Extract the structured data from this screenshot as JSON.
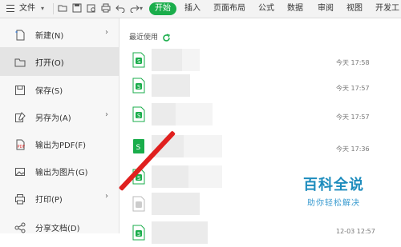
{
  "toolbar": {
    "file_menu_label": "文件",
    "tabs": [
      "开始",
      "插入",
      "页面布局",
      "公式",
      "数据",
      "审阅",
      "视图",
      "开发工"
    ]
  },
  "file_menu": {
    "items": [
      {
        "label": "新建(N)",
        "icon": "new-file-icon",
        "has_submenu": true
      },
      {
        "label": "打开(O)",
        "icon": "open-folder-icon",
        "has_submenu": false,
        "active": true
      },
      {
        "label": "保存(S)",
        "icon": "save-icon",
        "has_submenu": false
      },
      {
        "label": "另存为(A)",
        "icon": "save-as-icon",
        "has_submenu": true
      },
      {
        "label": "输出为PDF(F)",
        "icon": "export-pdf-icon",
        "has_submenu": false
      },
      {
        "label": "输出为图片(G)",
        "icon": "export-image-icon",
        "has_submenu": false
      },
      {
        "label": "打印(P)",
        "icon": "print-icon",
        "has_submenu": true
      },
      {
        "label": "分享文档(D)",
        "icon": "share-icon",
        "has_submenu": false
      }
    ]
  },
  "recent": {
    "title": "最近使用",
    "files": [
      {
        "time": "今天 17:58"
      },
      {
        "time": "今天 17:57"
      },
      {
        "time": "今天 17:57"
      },
      {
        "time": "今天 17:36"
      },
      {
        "time": ""
      },
      {
        "time": ""
      },
      {
        "time": "12-03 12:57"
      }
    ]
  },
  "watermark": {
    "title": "百科全说",
    "subtitle": "助你轻松解决"
  },
  "colors": {
    "accent_green": "#1aad4b",
    "watermark_blue": "#1d8cbd",
    "annotation_red": "#e0201f"
  }
}
